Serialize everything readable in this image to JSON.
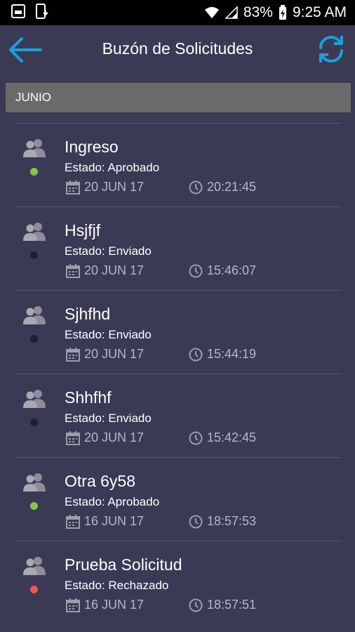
{
  "status_bar": {
    "battery": "83%",
    "time": "9:25 AM"
  },
  "app_bar": {
    "title": "Buzón de Solicitudes"
  },
  "colors": {
    "background": "#3b3a55",
    "accent": "#1e9fd8",
    "approved": "#8bc34a",
    "sent": "#1f1f2e",
    "rejected": "#f2545b"
  },
  "section": {
    "label": "JUNIO"
  },
  "items": [
    {
      "title": "Ingreso",
      "status": "Estado: Aprobado",
      "date": "20 JUN 17",
      "time": "20:21:45",
      "dot": "approved"
    },
    {
      "title": "Hsjfjf",
      "status": "Estado: Enviado",
      "date": "20 JUN 17",
      "time": "15:46:07",
      "dot": "sent"
    },
    {
      "title": "Sjhfhd",
      "status": "Estado: Enviado",
      "date": "20 JUN 17",
      "time": "15:44:19",
      "dot": "sent"
    },
    {
      "title": "Shhfhf",
      "status": "Estado: Enviado",
      "date": "20 JUN 17",
      "time": "15:42:45",
      "dot": "sent"
    },
    {
      "title": "Otra 6y58",
      "status": "Estado: Aprobado",
      "date": "16 JUN 17",
      "time": "18:57:53",
      "dot": "approved"
    },
    {
      "title": "Prueba Solicitud",
      "status": "Estado: Rechazado",
      "date": "16 JUN 17",
      "time": "18:57:51",
      "dot": "rejected"
    }
  ]
}
